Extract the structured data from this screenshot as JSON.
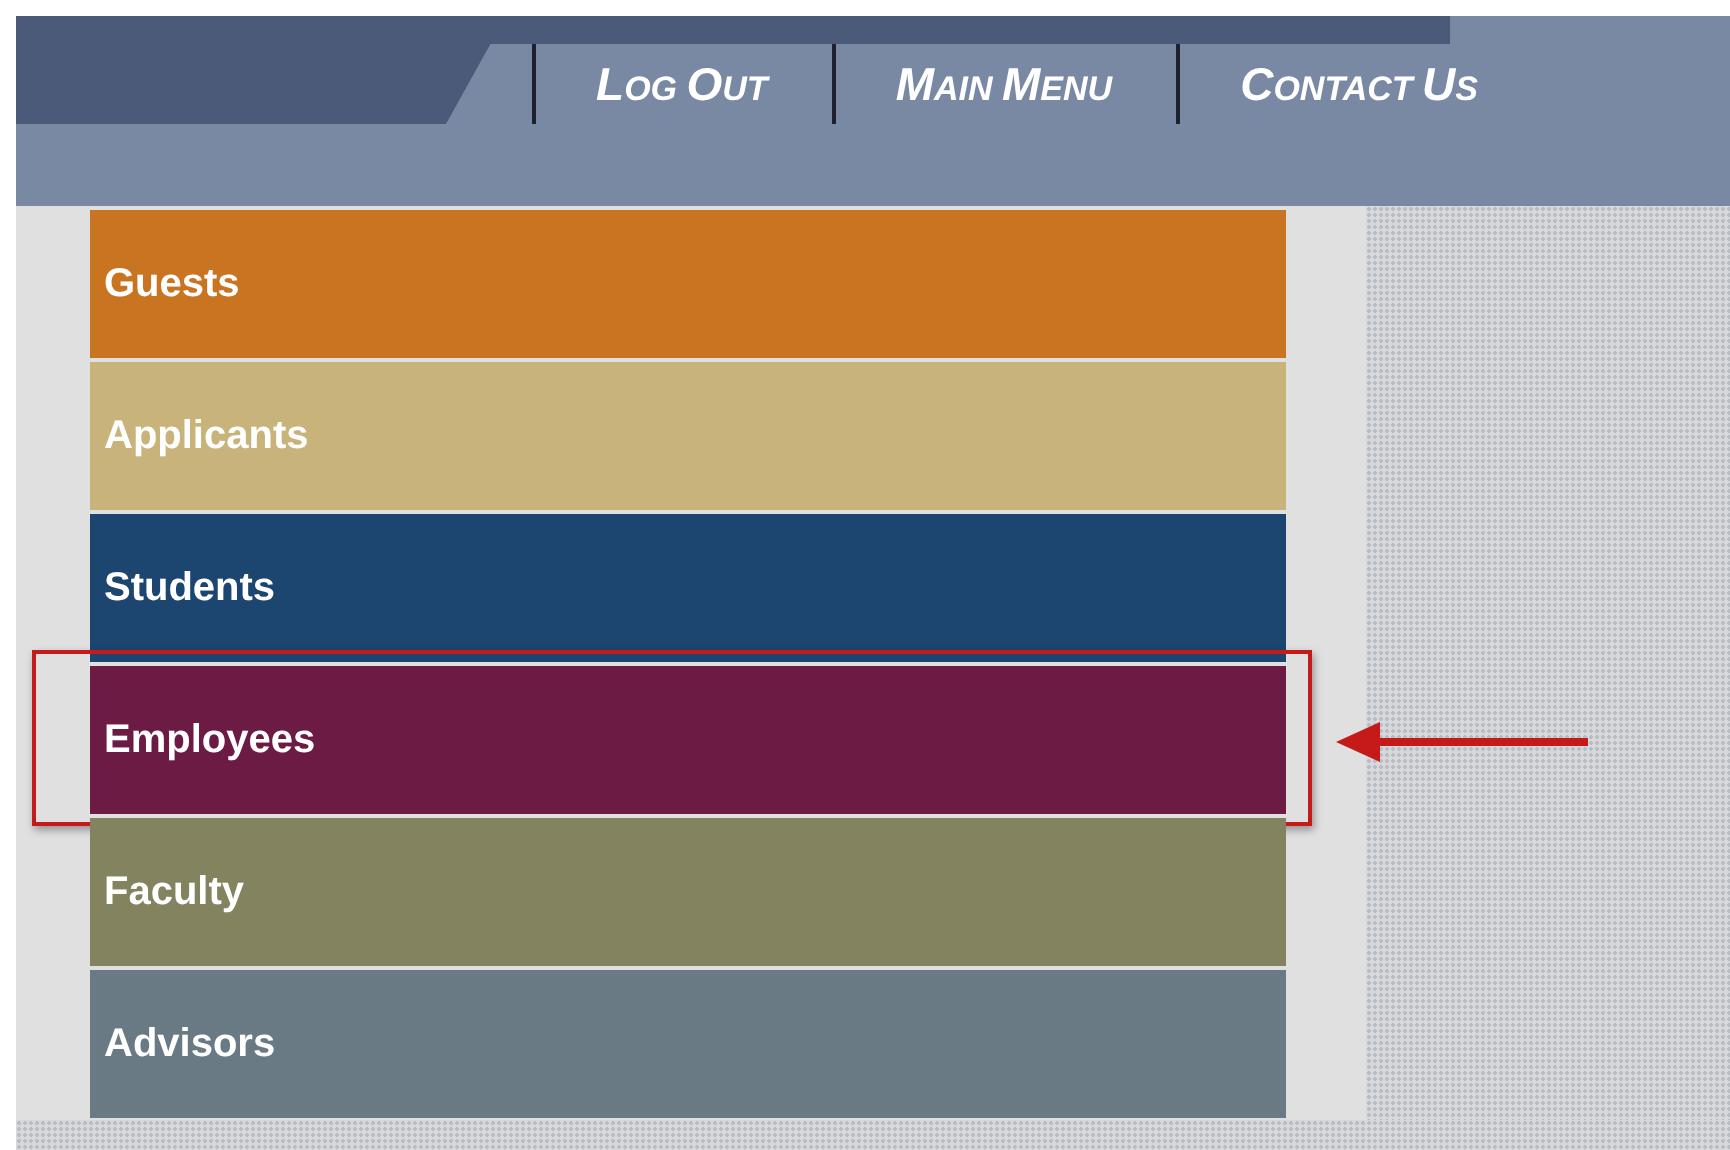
{
  "nav": [
    {
      "label": "LOG OUT"
    },
    {
      "label": "MAIN MENU"
    },
    {
      "label": "CONTACT US"
    }
  ],
  "menu": [
    {
      "label": "Guests",
      "color": "#c87421",
      "selected": false
    },
    {
      "label": "Applicants",
      "color": "#c8b47a",
      "selected": false
    },
    {
      "label": "Students",
      "color": "#1c4670",
      "selected": false
    },
    {
      "label": "Employees",
      "color": "#6b1b44",
      "selected": true
    },
    {
      "label": "Faculty",
      "color": "#838360",
      "selected": false
    },
    {
      "label": "Advisors",
      "color": "#6a7a84",
      "selected": false
    }
  ]
}
